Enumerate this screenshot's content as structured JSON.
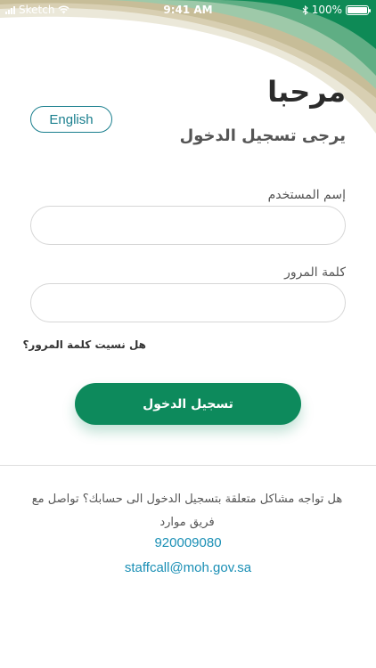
{
  "status_bar": {
    "carrier": "Sketch",
    "time": "9:41 AM",
    "battery": "100%",
    "battery_level": 1.0
  },
  "colors": {
    "primary_green": "#0d8a5c",
    "link_blue": "#1a8fb5",
    "lang_button_border": "#1a7f8e",
    "header_wave_green": "#0e8a56",
    "header_wave_tan": "#cfc6a7"
  },
  "header": {
    "welcome": "مرحبا",
    "subtitle": "يرجى تسجيل الدخول"
  },
  "language_button": {
    "label": "English"
  },
  "form": {
    "username_label": "إسم المستخدم",
    "username_value": "",
    "password_label": "كلمة المرور",
    "password_value": "",
    "forgot_password": "هل نسيت كلمة المرور؟",
    "login_button": "تسجيل الدخول"
  },
  "support": {
    "message": "هل تواجه مشاكل متعلقة بتسجيل الدخول الى حسابك؟ تواصل مع فريق موارد",
    "phone": "920009080",
    "email": "staffcall@moh.gov.sa"
  }
}
